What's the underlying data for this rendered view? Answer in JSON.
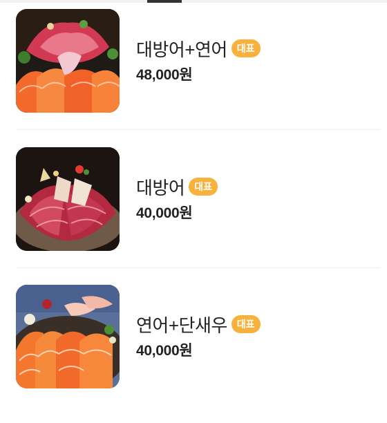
{
  "menu": {
    "items": [
      {
        "name": "대방어+연어",
        "badge": "대표",
        "price": "48,000원",
        "image": "yellowtail-salmon-platter"
      },
      {
        "name": "대방어",
        "badge": "대표",
        "price": "40,000원",
        "image": "yellowtail-platter"
      },
      {
        "name": "연어+단새우",
        "badge": "대표",
        "price": "40,000원",
        "image": "salmon-shrimp-platter"
      }
    ]
  },
  "colors": {
    "badge": "#f7b13c",
    "divider": "#eeeeee",
    "salmon": "#f26b2b",
    "tuna": "#c9304a"
  }
}
